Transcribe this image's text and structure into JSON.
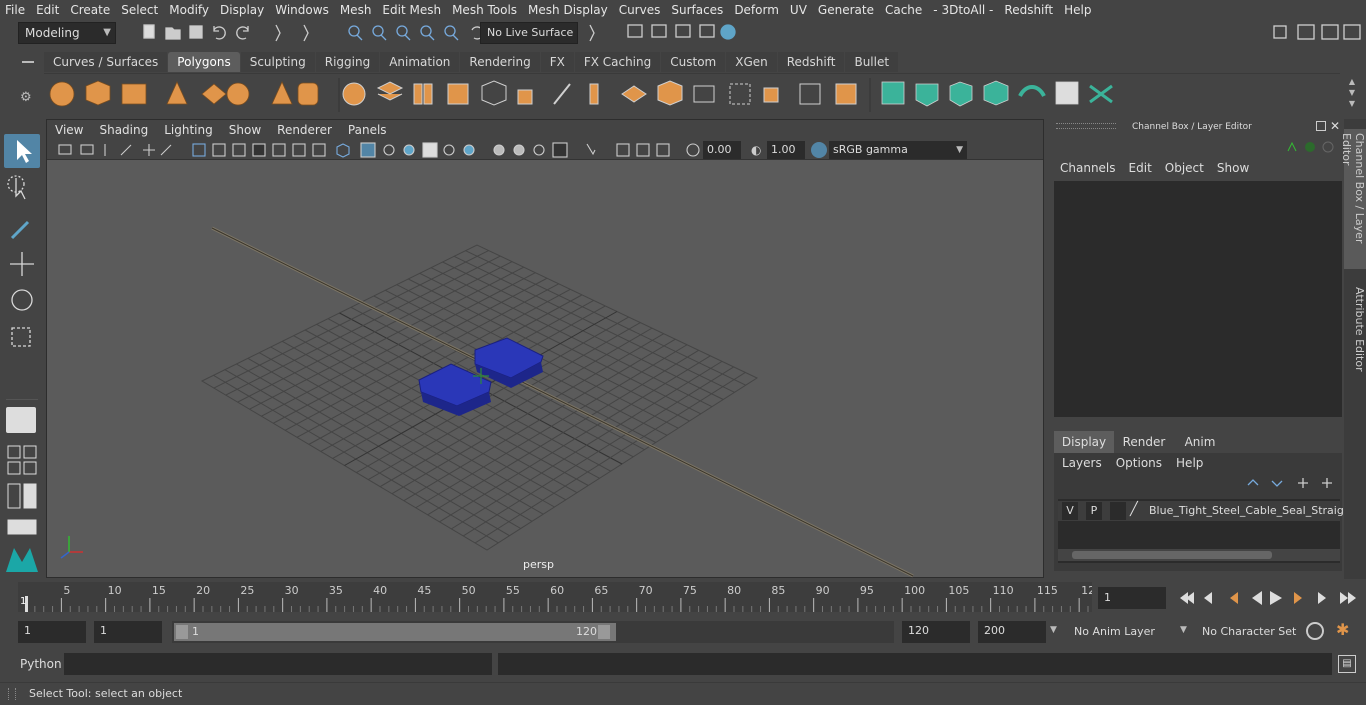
{
  "menubar": {
    "items": [
      "File",
      "Edit",
      "Create",
      "Select",
      "Modify",
      "Display",
      "Windows",
      "Mesh",
      "Edit Mesh",
      "Mesh Tools",
      "Mesh Display",
      "Curves",
      "Surfaces",
      "Deform",
      "UV",
      "Generate",
      "Cache",
      "- 3DtoAll -",
      "Redshift",
      "Help"
    ]
  },
  "status": {
    "mode": "Modeling",
    "live_surface": "No Live Surface"
  },
  "shelf": {
    "tabs": [
      "Curves / Surfaces",
      "Polygons",
      "Sculpting",
      "Rigging",
      "Animation",
      "Rendering",
      "FX",
      "FX Caching",
      "Custom",
      "XGen",
      "Redshift",
      "Bullet"
    ],
    "active_tab": "Polygons"
  },
  "viewport": {
    "menus": [
      "View",
      "Shading",
      "Lighting",
      "Show",
      "Renderer",
      "Panels"
    ],
    "exposure": "0.00",
    "gamma": "1.00",
    "color_space": "sRGB gamma",
    "camera_label": "persp"
  },
  "channel_box": {
    "title": "Channel Box / Layer Editor",
    "menus": [
      "Channels",
      "Edit",
      "Object",
      "Show"
    ]
  },
  "layer_editor": {
    "tabs": [
      "Display",
      "Render",
      "Anim"
    ],
    "active_tab": "Display",
    "menus": [
      "Layers",
      "Options",
      "Help"
    ],
    "layer": {
      "visible": "V",
      "playback": "P",
      "name": "Blue_Tight_Steel_Cable_Seal_Straight"
    }
  },
  "side_tabs": [
    "Channel Box / Layer Editor",
    "Attribute Editor"
  ],
  "timeline": {
    "ticks": [
      "5",
      "10",
      "15",
      "20",
      "25",
      "30",
      "35",
      "40",
      "45",
      "50",
      "55",
      "60",
      "65",
      "70",
      "75",
      "80",
      "85",
      "90",
      "95",
      "100",
      "105",
      "110",
      "115",
      "12"
    ],
    "start_label": "1",
    "current_frame": "1"
  },
  "range": {
    "start": "1",
    "playback_start": "1",
    "slider_start": "1",
    "slider_end": "120",
    "playback_end": "120",
    "end": "200",
    "anim_layer": "No Anim Layer",
    "character_set": "No Character Set"
  },
  "command_line": {
    "language": "Python"
  },
  "help_line": {
    "text": "Select Tool: select an object"
  },
  "colors": {
    "accent": "#5285a6",
    "shelf_orange": "#e0954a",
    "shelf_green": "#3bb39a",
    "object_blue": "#2a37b8"
  }
}
